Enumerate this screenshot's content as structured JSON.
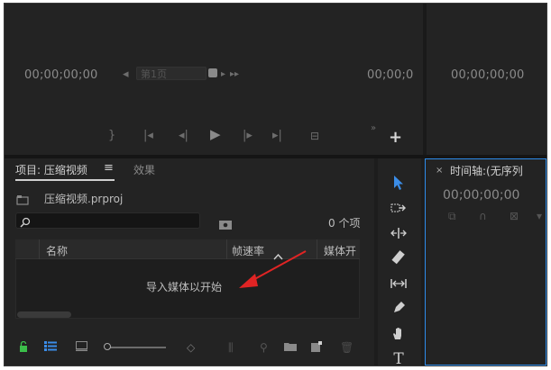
{
  "source_monitor": {
    "timecode_left": "00;00;00;00",
    "page_label": "第1页",
    "timecode_right": "00;00;0"
  },
  "program_monitor": {
    "timecode": "00;00;00;00"
  },
  "project_panel": {
    "tab_label": "项目: 压缩视频",
    "tab_menu_icon": "≡",
    "effects_tab": "效果",
    "project_file": "压缩视频.prproj",
    "item_count": "0 个项",
    "columns": [
      "名称",
      "帧速率",
      "媒体开"
    ],
    "empty_message": "导入媒体以开始"
  },
  "timeline_panel": {
    "close_icon": "×",
    "title": "时间轴:(无序列",
    "timecode": "00;00;00;00"
  },
  "colors": {
    "accent_blue": "#3b8de8",
    "red_arrow": "#e02424",
    "panel_bg": "#232323",
    "lock_green": "#3bbf4a"
  },
  "icons": [
    "lock-icon",
    "list-view-icon",
    "icon-view-icon",
    "zoom-slider",
    "sort-icon",
    "automate-icon",
    "find-icon",
    "new-bin-icon",
    "new-item-icon",
    "clear-icon",
    "selection-tool-icon",
    "track-select-icon",
    "ripple-edit-icon",
    "razor-icon",
    "slip-icon",
    "pen-icon",
    "hand-icon",
    "type-icon"
  ]
}
